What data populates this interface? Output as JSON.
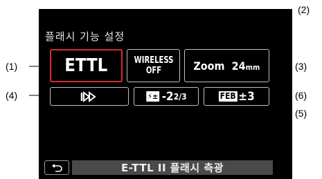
{
  "screen": {
    "title": "플래시 기능 설정",
    "ettl_label": "ETTL",
    "wireless_line1": "WIRELESS",
    "wireless_line2": "OFF",
    "zoom_label": "Zoom",
    "zoom_value": "24",
    "zoom_unit": "mm",
    "sync_icon": "second-curtain-sync-icon",
    "fec_value": "-2",
    "fec_fraction": "2/3",
    "feb_badge": "FEB",
    "feb_value": "±3",
    "footer_text": "E-TTL II 플래시 측광"
  },
  "callouts": {
    "c1": "(1)",
    "c2": "(2)",
    "c3": "(3)",
    "c4": "(4)",
    "c5": "(5)",
    "c6": "(6)"
  },
  "colors": {
    "selected_border": "#d62c33",
    "background": "#000000",
    "footer_bar": "#4a4a4a"
  }
}
